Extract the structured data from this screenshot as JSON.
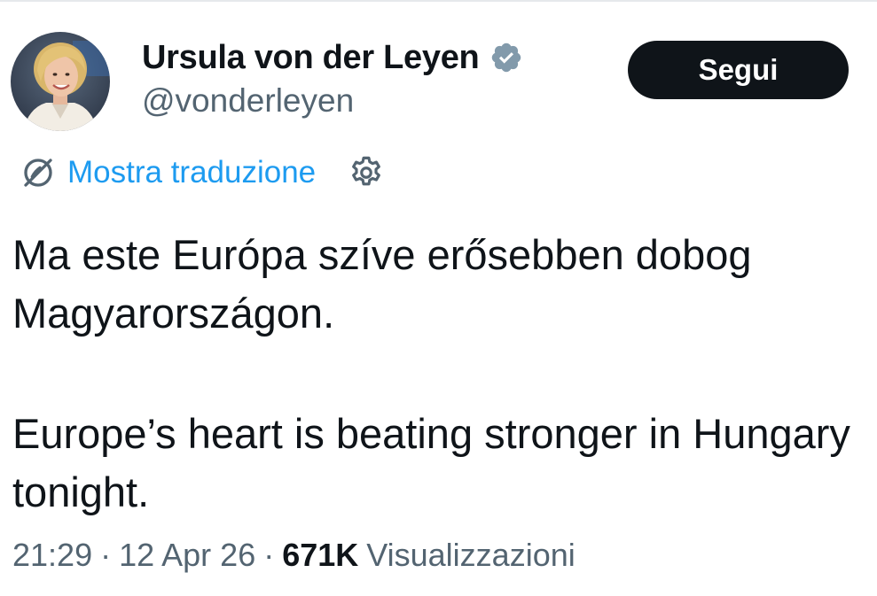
{
  "author": {
    "display_name": "Ursula von der Leyen",
    "handle": "@vonderleyen",
    "verified": true,
    "verified_icon": "verified-badge-icon",
    "avatar_icon": "profile-photo"
  },
  "follow_button": {
    "label": "Segui"
  },
  "translation": {
    "label": "Mostra traduzione",
    "icon": "globe-slash-icon",
    "settings_icon": "gear-icon",
    "link_color": "#1d9bf0"
  },
  "tweet": {
    "paragraphs": [
      "Ma este Európa szíve erősebben dobog Magyarországon.",
      "Europe’s heart is beating stronger in Hungary tonight."
    ]
  },
  "meta": {
    "time": "21:29",
    "separator": "·",
    "date": "12 Apr 26",
    "views_count": "671K",
    "views_label": "Visualizzazioni"
  },
  "colors": {
    "text_primary": "#0f1419",
    "text_secondary": "#536471",
    "verified_badge": "#829aab",
    "button_bg": "#0f1419"
  }
}
